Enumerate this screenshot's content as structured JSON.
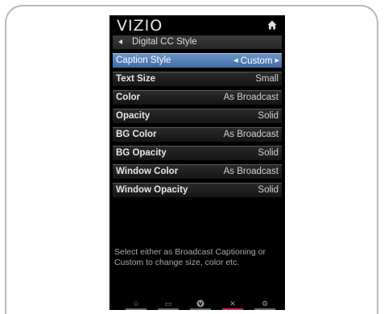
{
  "brand": {
    "logo_text": "VIZIO",
    "home_icon": "home-icon"
  },
  "breadcrumb": {
    "label": "Digital CC Style",
    "icon": "back-arrow-icon"
  },
  "menu": {
    "items": [
      {
        "label": "Caption Style",
        "value": "Custom",
        "selected": true
      },
      {
        "label": "Text Size",
        "value": "Small"
      },
      {
        "label": "Color",
        "value": "As Broadcast"
      },
      {
        "label": "Opacity",
        "value": "Solid"
      },
      {
        "label": "BG Color",
        "value": "As Broadcast"
      },
      {
        "label": "BG Opacity",
        "value": "Solid"
      },
      {
        "label": "Window Color",
        "value": "As Broadcast"
      },
      {
        "label": "Window Opacity",
        "value": "Solid"
      }
    ]
  },
  "help": {
    "text": "Select either as Broadcast Captioning or Custom to change size, color etc."
  },
  "bottom_bar": {
    "buttons": [
      {
        "name": "star-icon",
        "glyph": "☆"
      },
      {
        "name": "caption-icon",
        "glyph": "▭"
      },
      {
        "name": "v-button-icon",
        "glyph": "♥"
      },
      {
        "name": "exit-icon",
        "glyph": "✕"
      },
      {
        "name": "settings-icon",
        "glyph": "⚙"
      }
    ]
  },
  "colors": {
    "selected_row": "#4f78b2",
    "exit_accent": "#c0306a",
    "background": "#000000"
  }
}
